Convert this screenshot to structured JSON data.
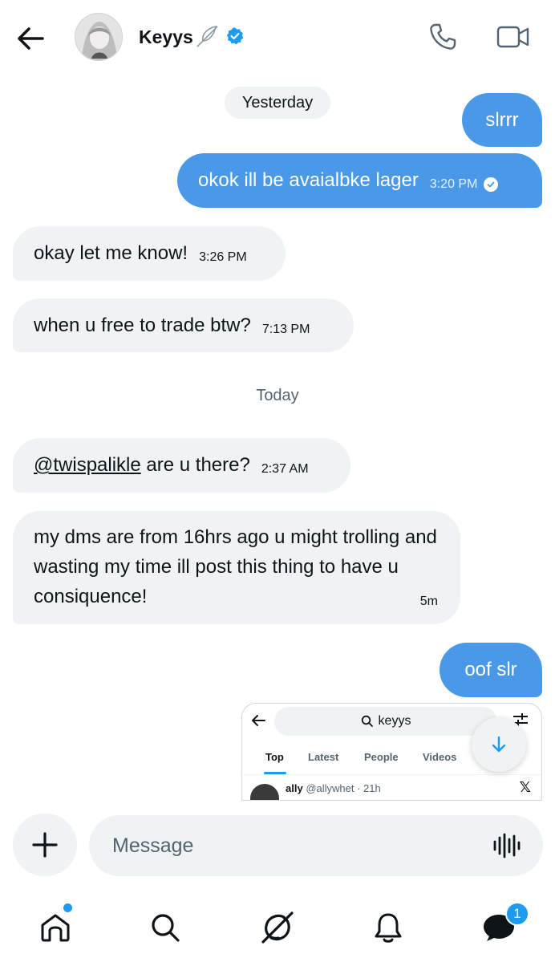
{
  "header": {
    "contact_name": "Keyys",
    "back_icon": "arrow-left-icon",
    "call_icon": "phone-icon",
    "video_icon": "video-camera-icon",
    "verified_color": "#1d9bf0"
  },
  "conversation": {
    "date_yesterday": "Yesterday",
    "date_today": "Today",
    "messages": [
      {
        "direction": "out",
        "text": "slrrr",
        "time": ""
      },
      {
        "direction": "out",
        "text": "okok ill be avaialbke lager",
        "time": "3:20 PM"
      },
      {
        "direction": "in",
        "text": "okay let me know!",
        "time": "3:26 PM"
      },
      {
        "direction": "in",
        "text": "when u free to trade btw?",
        "time": "7:13 PM"
      },
      {
        "direction": "in",
        "mention": "@twispalikle",
        "text": " are u there?",
        "time": "2:37 AM"
      },
      {
        "direction": "in",
        "text": "my dms are from 16hrs ago u might trolling and wasting my time ill post this thing to have u consiquence!",
        "time": "5m"
      },
      {
        "direction": "out",
        "text": "oof slr",
        "time": ""
      }
    ],
    "embedded_screenshot": {
      "search_query": "keyys",
      "tabs": [
        "Top",
        "Latest",
        "People",
        "Videos"
      ],
      "active_tab": "Top",
      "post_user": "ally",
      "post_handle": "@allywhet · 21h",
      "x_logo": "𝕏"
    }
  },
  "composer": {
    "placeholder": "Message",
    "add_icon": "plus-icon",
    "voice_icon": "voice-waveform-icon"
  },
  "nav": {
    "items": [
      "home-icon",
      "search-icon",
      "grok-icon",
      "bell-icon",
      "messages-icon"
    ],
    "messages_badge": "1"
  },
  "colors": {
    "outgoing_bubble": "#4a99e9",
    "incoming_bubble": "#eff3f4",
    "accent": "#1d9bf0"
  }
}
